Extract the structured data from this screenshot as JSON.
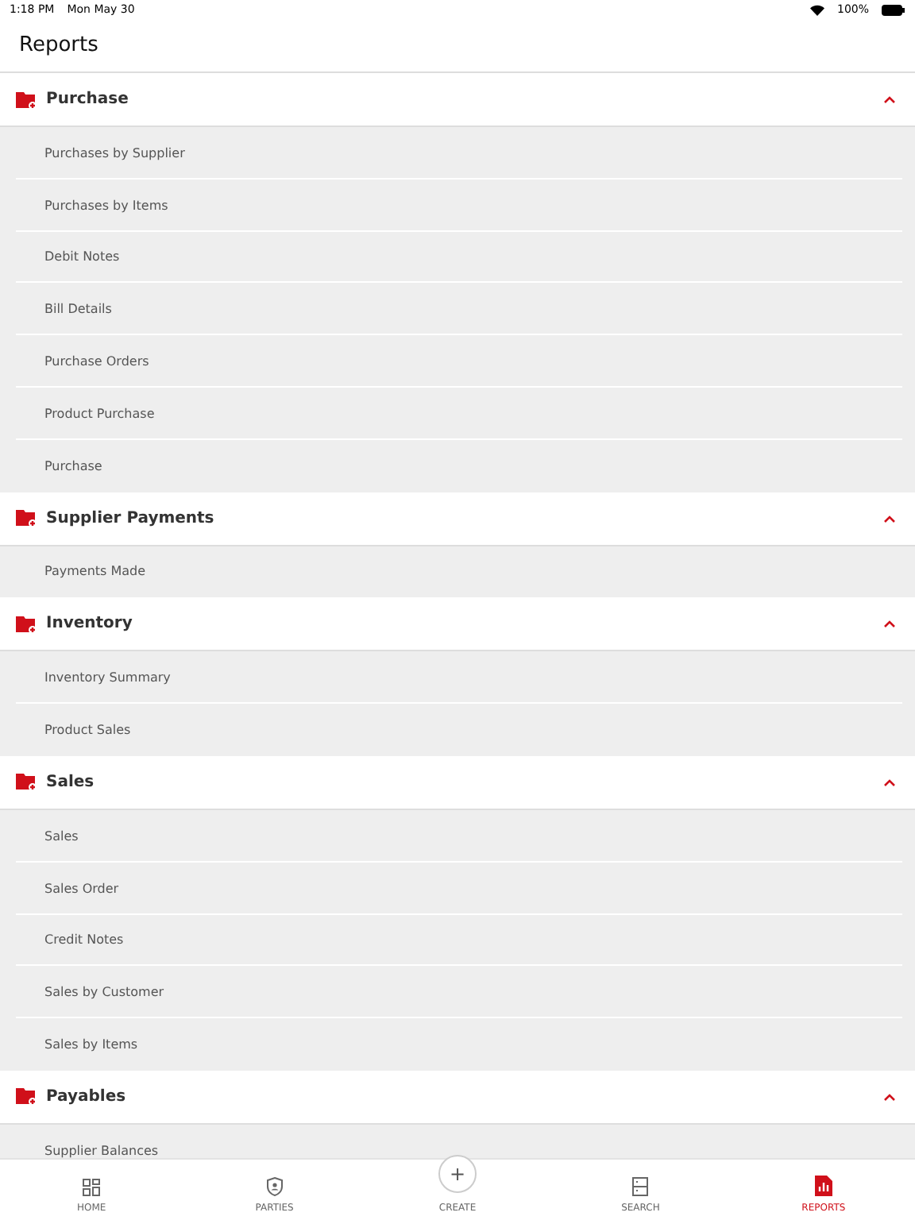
{
  "status_bar": {
    "time": "1:18 PM",
    "date": "Mon May 30",
    "battery": "100%"
  },
  "header": {
    "title": "Reports"
  },
  "sections": [
    {
      "title": "Purchase",
      "expanded": true,
      "items": [
        "Purchases by Supplier",
        "Purchases by Items",
        "Debit Notes",
        "Bill Details",
        "Purchase Orders",
        "Product Purchase",
        "Purchase"
      ]
    },
    {
      "title": "Supplier Payments",
      "expanded": true,
      "items": [
        "Payments Made"
      ]
    },
    {
      "title": "Inventory",
      "expanded": true,
      "items": [
        "Inventory Summary",
        "Product Sales"
      ]
    },
    {
      "title": "Sales",
      "expanded": true,
      "items": [
        "Sales",
        "Sales Order",
        "Credit Notes",
        "Sales by Customer",
        "Sales by Items"
      ]
    },
    {
      "title": "Payables",
      "expanded": true,
      "items": [
        "Supplier Balances"
      ]
    }
  ],
  "tab_bar": [
    {
      "kind": "home",
      "label": "HOME",
      "selected": false
    },
    {
      "kind": "parties",
      "label": "PARTIES",
      "selected": false
    },
    {
      "kind": "create",
      "label": "CREATE",
      "symbol": "+",
      "selected": false
    },
    {
      "kind": "search",
      "label": "SEARCH",
      "selected": false
    },
    {
      "kind": "reports",
      "label": "REPORTS",
      "selected": true
    }
  ]
}
